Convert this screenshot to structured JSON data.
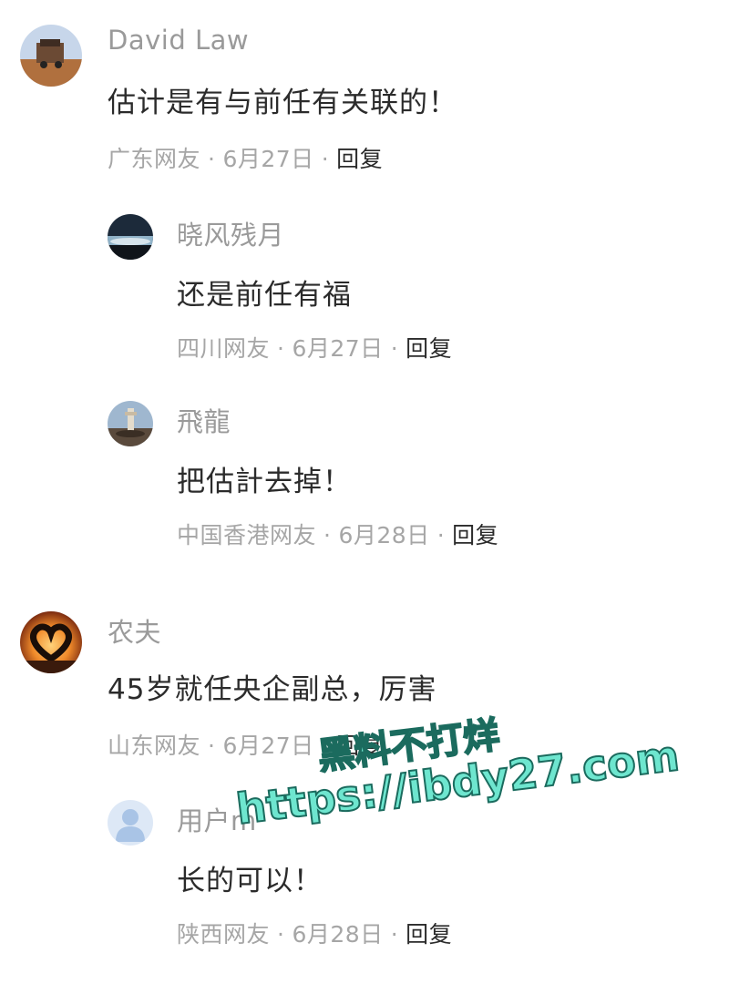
{
  "comments": [
    {
      "name": "David Law",
      "text": "估计是有与前任有关联的！",
      "location": "广东网友",
      "date": "6月27日",
      "reply_label": "回复",
      "replies": [
        {
          "name": "晓风残月",
          "text": "还是前任有福",
          "location": "四川网友",
          "date": "6月27日",
          "reply_label": "回复"
        },
        {
          "name": "飛龍",
          "text": "把估計去掉！",
          "location": "中国香港网友",
          "date": "6月28日",
          "reply_label": "回复"
        }
      ]
    },
    {
      "name": "农夫",
      "text": "45岁就任央企副总，厉害",
      "location": "山东网友",
      "date": "6月27日",
      "reply_label": "回复",
      "replies": [
        {
          "name": "用户m",
          "text": "长的可以！",
          "location": "陕西网友",
          "date": "6月28日",
          "reply_label": "回复"
        }
      ]
    }
  ],
  "separator": "·",
  "watermark": {
    "line1": "黑料不打烊",
    "line2": "https://ibdy27.com"
  },
  "colors": {
    "name": "#9a9a9a",
    "text": "#2b2b2b",
    "meta": "#a6a6a6",
    "watermark_fill": "#6ee6cf",
    "watermark_stroke": "#1b6b5e"
  }
}
